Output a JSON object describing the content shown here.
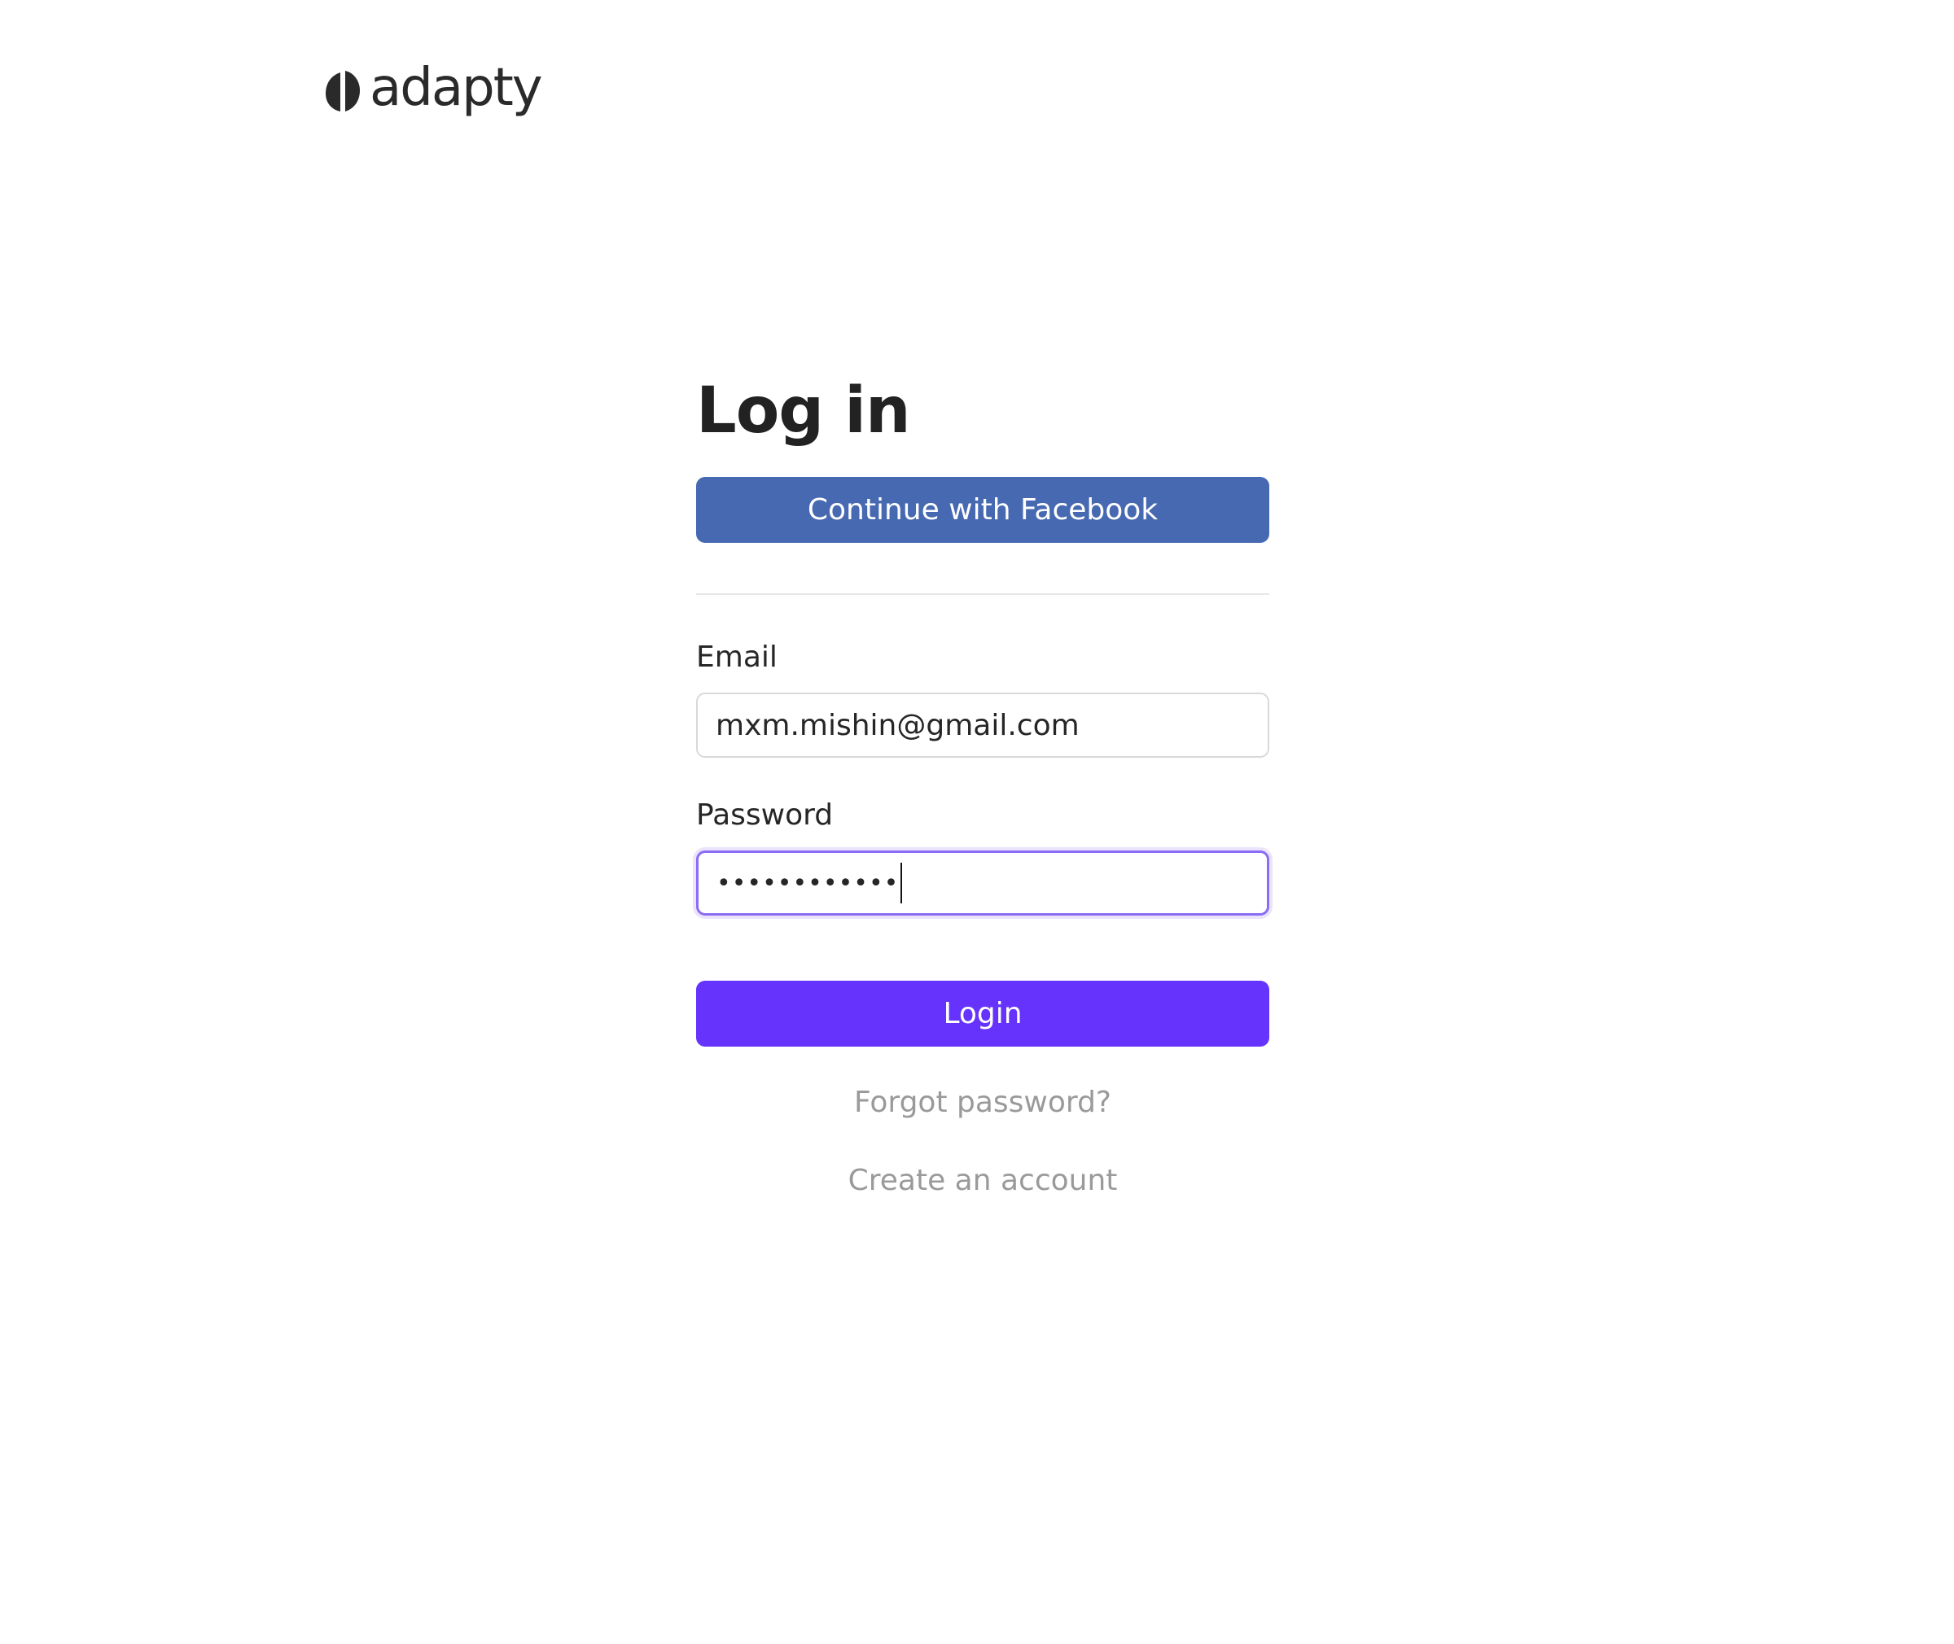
{
  "brand": {
    "name": "adapty",
    "logo_icon": "adapty-leaf-icon"
  },
  "form": {
    "title": "Log in",
    "facebook_button": "Continue with Facebook",
    "email_label": "Email",
    "email_value": "mxm.mishin@gmail.com",
    "password_label": "Password",
    "password_mask": "••••••••••••",
    "login_button": "Login",
    "forgot_link": "Forgot password?",
    "create_link": "Create an account"
  },
  "colors": {
    "facebook": "#4669b1",
    "primary": "#6533fb",
    "focus_ring": "#8a6cf5",
    "muted_text": "#9a9a9a"
  }
}
